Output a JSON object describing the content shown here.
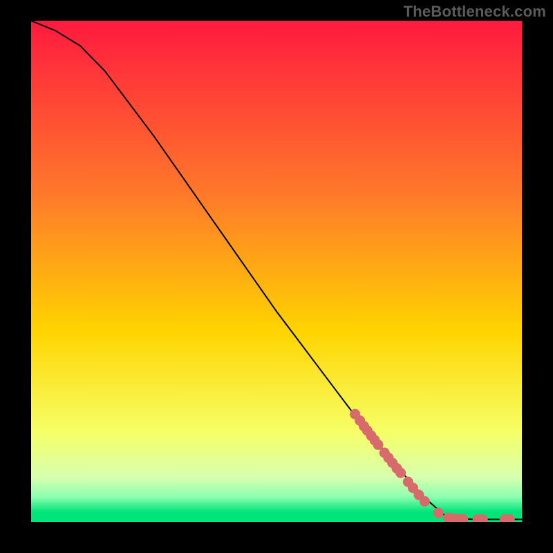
{
  "watermark": "TheBottleneck.com",
  "chart_data": {
    "type": "line",
    "title": "",
    "xlabel": "",
    "ylabel": "",
    "xlim": [
      0,
      100
    ],
    "ylim": [
      0,
      100
    ],
    "curve": [
      {
        "x": 0,
        "y": 100
      },
      {
        "x": 5,
        "y": 98
      },
      {
        "x": 10,
        "y": 95
      },
      {
        "x": 15,
        "y": 90
      },
      {
        "x": 20,
        "y": 83.5
      },
      {
        "x": 25,
        "y": 77
      },
      {
        "x": 30,
        "y": 70
      },
      {
        "x": 35,
        "y": 63
      },
      {
        "x": 40,
        "y": 56
      },
      {
        "x": 45,
        "y": 49
      },
      {
        "x": 50,
        "y": 42
      },
      {
        "x": 55,
        "y": 35.5
      },
      {
        "x": 60,
        "y": 29
      },
      {
        "x": 65,
        "y": 22.5
      },
      {
        "x": 70,
        "y": 16.5
      },
      {
        "x": 75,
        "y": 10.5
      },
      {
        "x": 80,
        "y": 5
      },
      {
        "x": 84,
        "y": 1.5
      },
      {
        "x": 86,
        "y": 0.8
      },
      {
        "x": 90,
        "y": 0.5
      },
      {
        "x": 95,
        "y": 0.5
      },
      {
        "x": 100,
        "y": 0.5
      }
    ],
    "markers": [
      {
        "x": 66,
        "y": 21.5
      },
      {
        "x": 67,
        "y": 20.2
      },
      {
        "x": 67.8,
        "y": 19.1
      },
      {
        "x": 68.5,
        "y": 18.2
      },
      {
        "x": 69.3,
        "y": 17.2
      },
      {
        "x": 70.0,
        "y": 16.3
      },
      {
        "x": 70.7,
        "y": 15.4
      },
      {
        "x": 72.0,
        "y": 13.8
      },
      {
        "x": 72.8,
        "y": 12.8
      },
      {
        "x": 73.6,
        "y": 11.8
      },
      {
        "x": 74.5,
        "y": 10.7
      },
      {
        "x": 75.3,
        "y": 9.8
      },
      {
        "x": 76.8,
        "y": 8.0
      },
      {
        "x": 77.8,
        "y": 6.8
      },
      {
        "x": 79.0,
        "y": 5.4
      },
      {
        "x": 80.2,
        "y": 4.1
      },
      {
        "x": 83.0,
        "y": 1.8
      },
      {
        "x": 85.0,
        "y": 0.8
      },
      {
        "x": 86.0,
        "y": 0.7
      },
      {
        "x": 87.0,
        "y": 0.6
      },
      {
        "x": 88.0,
        "y": 0.55
      },
      {
        "x": 91.0,
        "y": 0.5
      },
      {
        "x": 92.0,
        "y": 0.5
      },
      {
        "x": 96.5,
        "y": 0.5
      },
      {
        "x": 97.5,
        "y": 0.5
      }
    ],
    "gradient_palette": {
      "top": "#ff1a3f",
      "mid1": "#ff7a2a",
      "mid2": "#ffd400",
      "mid3": "#f6ff66",
      "bottom": "#00e57a"
    },
    "marker_color": "#d76a6a"
  }
}
